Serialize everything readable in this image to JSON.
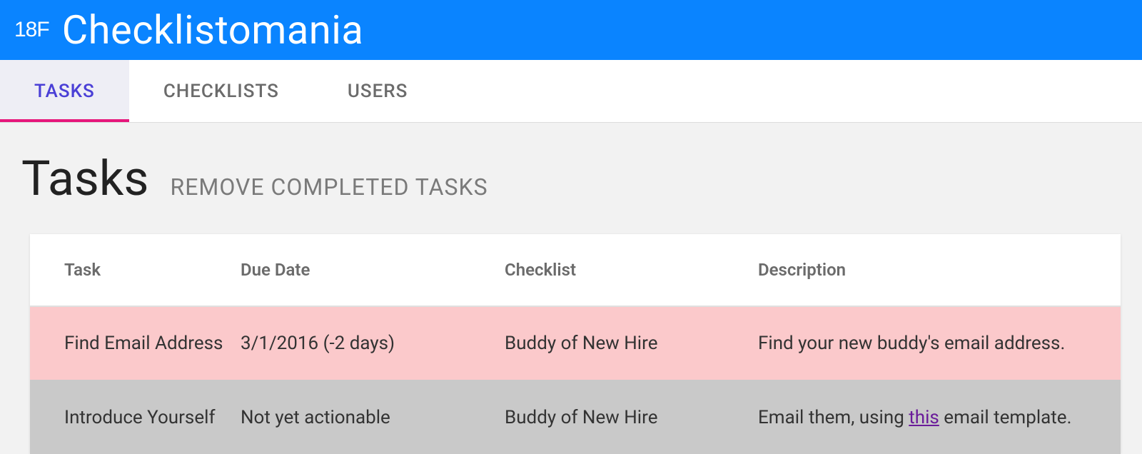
{
  "header": {
    "logo_mark": "18F",
    "app_title": "Checklistomania"
  },
  "tabs": [
    {
      "label": "TASKS",
      "active": true
    },
    {
      "label": "CHECKLISTS",
      "active": false
    },
    {
      "label": "USERS",
      "active": false
    }
  ],
  "page": {
    "title": "Tasks",
    "remove_label": "REMOVE COMPLETED TASKS"
  },
  "table": {
    "headers": {
      "task": "Task",
      "due": "Due Date",
      "checklist": "Checklist",
      "description": "Description"
    },
    "rows": [
      {
        "task": "Find Email Address",
        "due": "3/1/2016 (-2 days)",
        "checklist": "Buddy of New Hire",
        "desc_pre": "Find your new buddy's email address.",
        "link": "",
        "desc_post": "",
        "status": "overdue"
      },
      {
        "task": "Introduce Yourself",
        "due": "Not yet actionable",
        "checklist": "Buddy of New Hire",
        "desc_pre": "Email them, using ",
        "link": "this",
        "desc_post": " email template.",
        "status": "pending"
      }
    ]
  }
}
